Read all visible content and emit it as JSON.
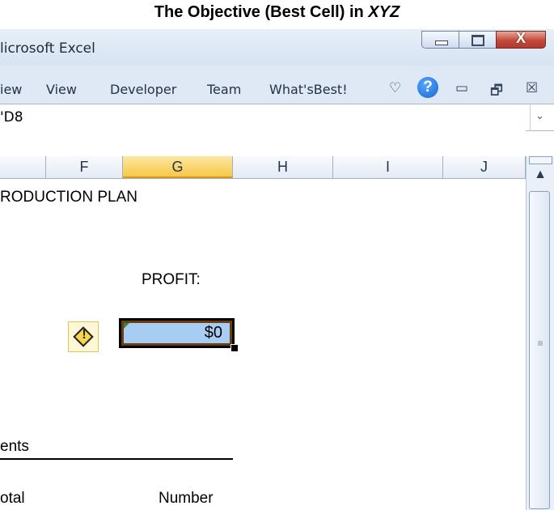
{
  "caption": {
    "text": "The Objective (Best Cell) in ",
    "emphasis": "XYZ"
  },
  "window": {
    "title": "licrosoft Excel",
    "buttons": {
      "minimize_icon": "minimize-icon",
      "maximize_icon": "maximize-icon",
      "close_symbol": "X"
    }
  },
  "ribbon": {
    "tabs": [
      "iew",
      "View",
      "Developer",
      "Team",
      "What'sBest!"
    ],
    "icons": {
      "heart": "♡",
      "help": "?",
      "minimize": "▭",
      "restore": "🗗",
      "close": "☒"
    }
  },
  "formula_bar": {
    "name_box": "'D8",
    "dropdown": "⌄"
  },
  "columns": [
    "F",
    "G",
    "H",
    "I",
    "J"
  ],
  "active_column": "G",
  "cells": {
    "heading": "RODUCTION PLAN",
    "profit_label": "PROFIT:",
    "profit_value": "$0",
    "section_label": "ents",
    "col_total": "otal",
    "col_number": "Number"
  },
  "scrollbar": {
    "up_arrow": "▲",
    "grip": "≡"
  },
  "colors": {
    "active_column_header": "#f7c848",
    "selected_cell_fill": "#a8cdf3",
    "accent_help": "#1567d3"
  }
}
